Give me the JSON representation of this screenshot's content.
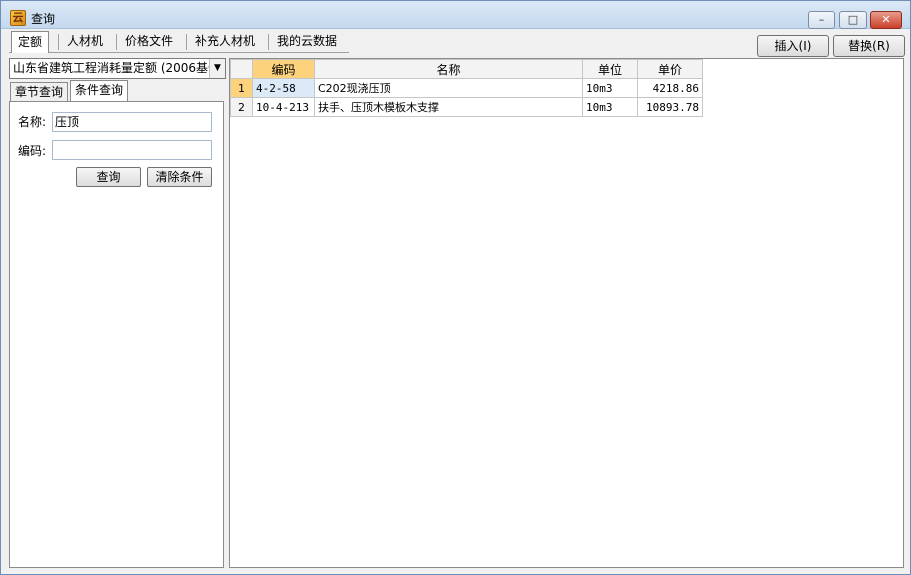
{
  "window": {
    "title": "查询",
    "icon": "app-icon",
    "controls": [
      "minimize-icon",
      "maximize-icon",
      "close-icon"
    ]
  },
  "top_tabs": [
    {
      "label": "定额",
      "active": true
    },
    {
      "label": "人材机",
      "active": false
    },
    {
      "label": "价格文件",
      "active": false
    },
    {
      "label": "补充人材机",
      "active": false
    },
    {
      "label": "我的云数据",
      "active": false
    }
  ],
  "actions": {
    "insert_label": "插入(I)",
    "replace_label": "替换(R)"
  },
  "left": {
    "quota_select_value": "山东省建筑工程消耗量定额 (2006基价",
    "sub_tabs": [
      {
        "label": "章节查询",
        "active": false
      },
      {
        "label": "条件查询",
        "active": true
      }
    ],
    "form": {
      "name_label": "名称:",
      "name_value": "压顶",
      "code_label": "编码:",
      "code_value": "",
      "query_label": "查询",
      "clear_label": "清除条件"
    }
  },
  "grid": {
    "headers": [
      "",
      "编码",
      "名称",
      "单位",
      "单价"
    ],
    "rows": [
      {
        "num": "1",
        "code": "4-2-58",
        "name": "C202现浇压顶",
        "unit": "10m3",
        "price": "4218.86"
      },
      {
        "num": "2",
        "code": "10-4-213",
        "name": "扶手、压顶木模板木支撑",
        "unit": "10m3",
        "price": "10893.78"
      }
    ]
  }
}
